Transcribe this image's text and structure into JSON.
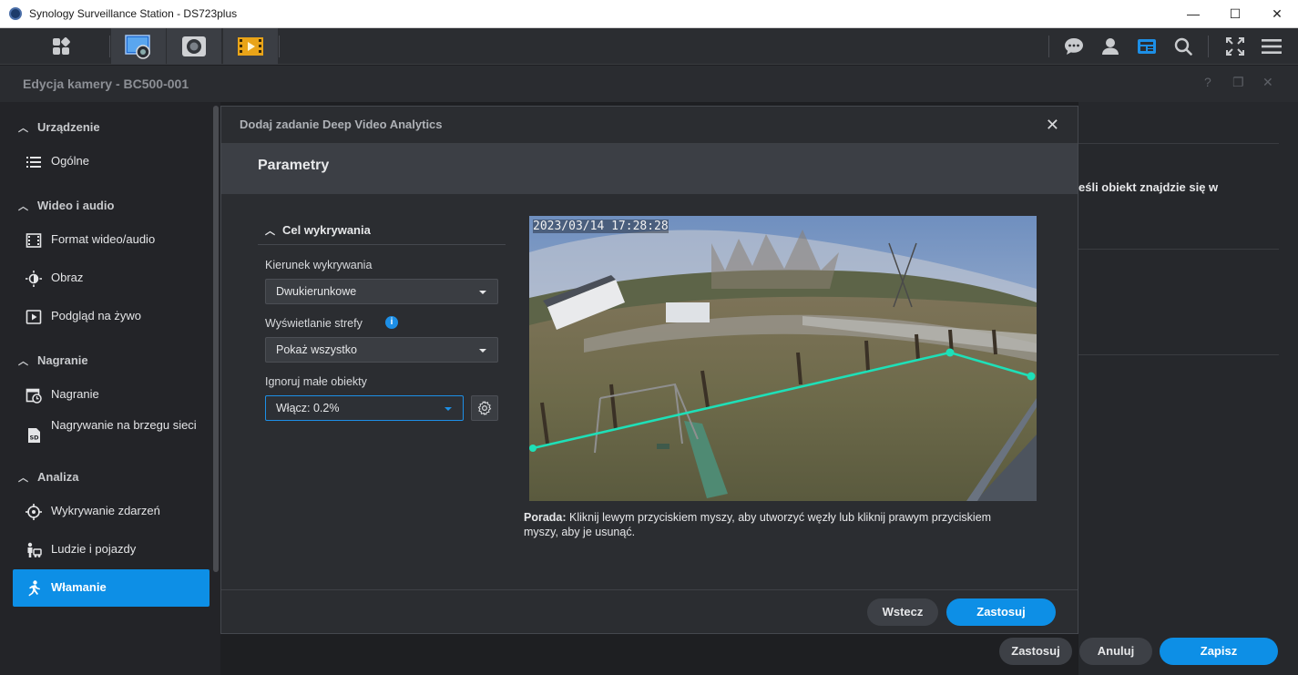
{
  "window": {
    "title": "Synology Surveillance Station - DS723plus",
    "minimize": "—",
    "maximize": "☐",
    "close": "✕"
  },
  "toolbar": {
    "left_buttons": [
      "dashboard-icon",
      "monitor-center-icon",
      "camera-icon",
      "recording-playback-icon"
    ],
    "right_buttons": [
      "chat-icon",
      "user-icon",
      "news-icon",
      "search-icon",
      "fullscreen-icon",
      "menu-icon"
    ]
  },
  "editor": {
    "title": "Edycja kamery - BC500-001",
    "help": "?",
    "restore": "❐",
    "close": "✕"
  },
  "sidebar": {
    "sections": [
      {
        "label": "Urządzenie",
        "items": [
          {
            "label": "Ogólne",
            "icon": "list-icon"
          }
        ]
      },
      {
        "label": "Wideo i audio",
        "items": [
          {
            "label": "Format wideo/audio",
            "icon": "film-icon"
          },
          {
            "label": "Obraz",
            "icon": "brightness-icon"
          },
          {
            "label": "Podgląd na żywo",
            "icon": "play-box-icon"
          }
        ]
      },
      {
        "label": "Nagranie",
        "items": [
          {
            "label": "Nagranie",
            "icon": "calendar-clock-icon"
          },
          {
            "label": "Nagrywanie na brzegu sieci",
            "icon": "sd-card-icon"
          }
        ]
      },
      {
        "label": "Analiza",
        "items": [
          {
            "label": "Wykrywanie zdarzeń",
            "icon": "crosshair-icon"
          },
          {
            "label": "Ludzie i pojazdy",
            "icon": "person-vehicle-icon"
          },
          {
            "label": "Włamanie",
            "icon": "running-person-icon",
            "active": true
          }
        ]
      }
    ]
  },
  "background_panel": {
    "text": "eśli obiekt znajdzie się w"
  },
  "footer": {
    "apply": "Zastosuj",
    "cancel": "Anuluj",
    "save": "Zapisz"
  },
  "dialog": {
    "title": "Dodaj zadanie Deep Video Analytics",
    "close": "✕",
    "band_title": "Parametry",
    "section_title": "Cel wykrywania",
    "fields": {
      "direction_label": "Kierunek wykrywania",
      "direction_value": "Dwukierunkowe",
      "zone_label": "Wyświetlanie strefy",
      "zone_value": "Pokaż wszystko",
      "ignore_label": "Ignoruj małe obiekty",
      "ignore_value": "Włącz: 0.2%"
    },
    "preview": {
      "timestamp": "2023/03/14 17:28:28"
    },
    "hint_bold": "Porada:",
    "hint_text": " Kliknij lewym przyciskiem myszy, aby utworzyć węzły lub kliknij prawym przyciskiem myszy, aby je usunąć.",
    "back": "Wstecz",
    "apply": "Zastosuj"
  },
  "colors": {
    "accent": "#0d8fe6",
    "line": "#1ee0b8"
  }
}
